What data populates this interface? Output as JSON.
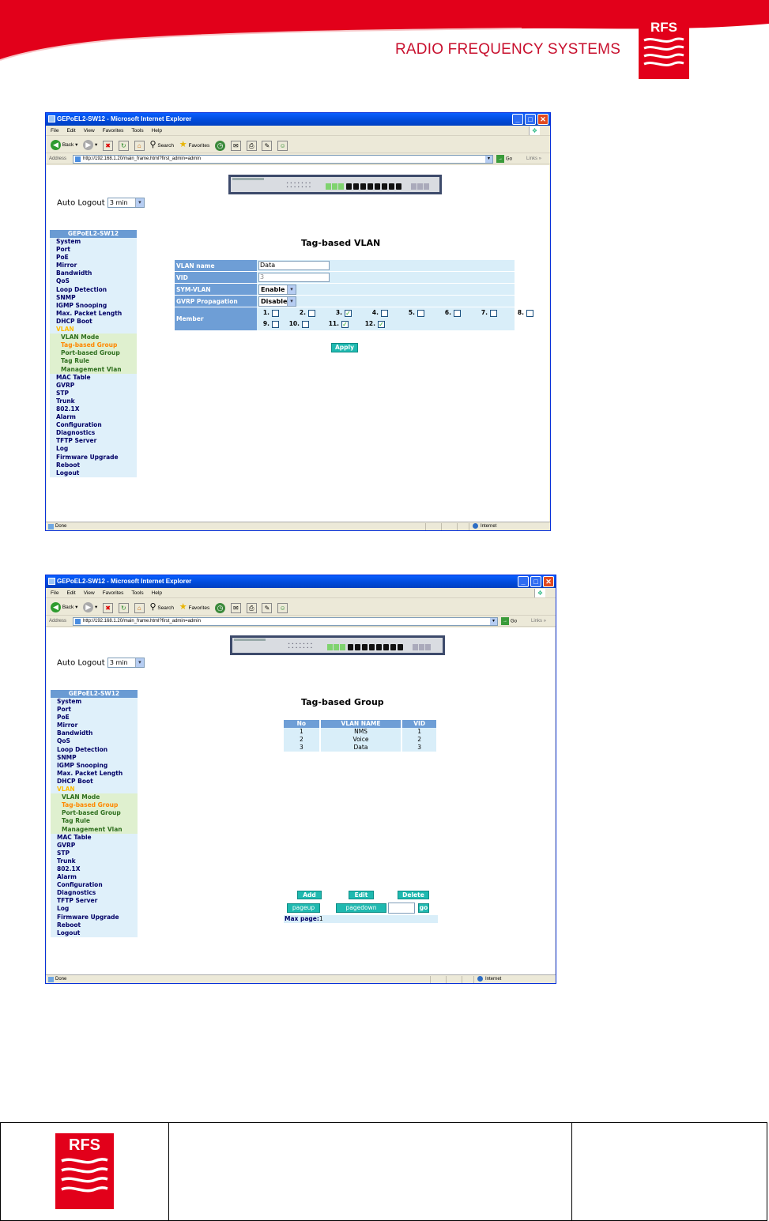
{
  "brand": {
    "name": "RADIO FREQUENCY SYSTEMS",
    "logo_text": "RFS"
  },
  "colors": {
    "brand_red": "#e2001a",
    "menu_head": "#6a9bd3",
    "menu_bg": "#dff0fa",
    "button": "#1fb9b0"
  },
  "window1": {
    "title": "GEPoEL2-SW12 - Microsoft Internet Explorer",
    "menus": [
      "File",
      "Edit",
      "View",
      "Favorites",
      "Tools",
      "Help"
    ],
    "toolbar": {
      "back": "Back",
      "search": "Search",
      "favorites": "Favorites"
    },
    "address_label": "Address",
    "address": "http://192.168.1.20/main_frame.html?first_admin=admin",
    "go": "Go",
    "links": "Links",
    "status": "Done",
    "zone": "Internet",
    "auto_logout_label": "Auto Logout",
    "auto_logout_value": "3 min",
    "menu_title": "GEPoEL2-SW12",
    "page_title": "Tag-based VLAN",
    "form": {
      "vlan_name_label": "VLAN name",
      "vlan_name_value": "Data",
      "vid_label": "VID",
      "vid_value": "3",
      "sym_label": "SYM-VLAN",
      "sym_value": "Enable",
      "gvrp_label": "GVRP Propagation",
      "gvrp_value": "Disable",
      "member_label": "Member",
      "ports": [
        {
          "label": "1.",
          "checked": false
        },
        {
          "label": "2.",
          "checked": false
        },
        {
          "label": "3.",
          "checked": true
        },
        {
          "label": "4.",
          "checked": false
        },
        {
          "label": "5.",
          "checked": false
        },
        {
          "label": "6.",
          "checked": false
        },
        {
          "label": "7.",
          "checked": false
        },
        {
          "label": "8.",
          "checked": false
        },
        {
          "label": "9.",
          "checked": false
        },
        {
          "label": "10.",
          "checked": false
        },
        {
          "label": "11.",
          "checked": true
        },
        {
          "label": "12.",
          "checked": true
        }
      ],
      "apply": "Apply"
    }
  },
  "window2": {
    "title": "GEPoEL2-SW12 - Microsoft Internet Explorer",
    "page_title": "Tag-based Group",
    "table": {
      "headers": [
        "No",
        "VLAN NAME",
        "VID"
      ],
      "rows": [
        [
          "1",
          "NMS",
          "1"
        ],
        [
          "2",
          "Voice",
          "2"
        ],
        [
          "3",
          "Data",
          "3"
        ]
      ]
    },
    "buttons": {
      "add": "Add",
      "edit": "Edit",
      "delete": "Delete",
      "pageup": "pageup",
      "pagedown": "pagedown",
      "go": "go"
    },
    "max_page_label": "Max page:",
    "max_page_value": "1"
  },
  "nav_menu": [
    {
      "label": "System",
      "kind": "item"
    },
    {
      "label": "Port",
      "kind": "item"
    },
    {
      "label": "PoE",
      "kind": "item"
    },
    {
      "label": "Mirror",
      "kind": "item"
    },
    {
      "label": "Bandwidth",
      "kind": "item"
    },
    {
      "label": "QoS",
      "kind": "item"
    },
    {
      "label": "Loop Detection",
      "kind": "item"
    },
    {
      "label": "SNMP",
      "kind": "item"
    },
    {
      "label": "IGMP Snooping",
      "kind": "item"
    },
    {
      "label": "Max. Packet Length",
      "kind": "item"
    },
    {
      "label": "DHCP Boot",
      "kind": "item"
    },
    {
      "label": "VLAN",
      "kind": "vlan"
    },
    {
      "label": "VLAN Mode",
      "kind": "sub"
    },
    {
      "label": "Tag-based Group",
      "kind": "sub-active"
    },
    {
      "label": "Port-based Group",
      "kind": "sub"
    },
    {
      "label": "Tag Rule",
      "kind": "sub"
    },
    {
      "label": "Management Vlan",
      "kind": "sub"
    },
    {
      "label": "MAC Table",
      "kind": "item"
    },
    {
      "label": "GVRP",
      "kind": "item"
    },
    {
      "label": "STP",
      "kind": "item"
    },
    {
      "label": "Trunk",
      "kind": "item"
    },
    {
      "label": "802.1X",
      "kind": "item"
    },
    {
      "label": "Alarm",
      "kind": "item"
    },
    {
      "label": "Configuration",
      "kind": "item"
    },
    {
      "label": "Diagnostics",
      "kind": "item"
    },
    {
      "label": "TFTP Server",
      "kind": "item"
    },
    {
      "label": "Log",
      "kind": "item"
    },
    {
      "label": "Firmware Upgrade",
      "kind": "item"
    },
    {
      "label": "Reboot",
      "kind": "item"
    },
    {
      "label": "Logout",
      "kind": "item"
    }
  ]
}
